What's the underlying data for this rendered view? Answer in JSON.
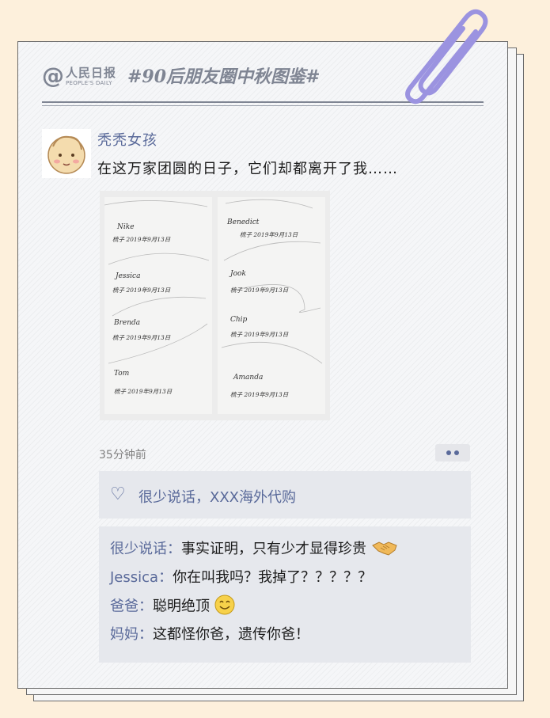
{
  "header": {
    "logo_cn": "人民日报",
    "logo_en": "PEOPLE'S DAILY",
    "hashtag": "#90后朋友圈中秋图鉴#"
  },
  "post": {
    "username": "秃秃女孩",
    "text": "在这万家团圆的日子，它们却都离开了我……",
    "photo": {
      "left_page": [
        {
          "name": "Nike",
          "line": "梳子 2019年9月13日"
        },
        {
          "name": "Jessica",
          "line": "梳子 2019年9月13日"
        },
        {
          "name": "Brenda",
          "line": "梳子 2019年9月13日"
        },
        {
          "name": "Tom",
          "line": "梳子 2019年9月13日"
        }
      ],
      "right_page": [
        {
          "name": "Benedict",
          "line": "梳子 2019年9月13日"
        },
        {
          "name": "Jook",
          "line": "梳子 2019年9月13日"
        },
        {
          "name": "Chip",
          "line": "梳子 2019年9月13日"
        },
        {
          "name": "Amanda",
          "line": "梳子 2019年9月13日"
        }
      ]
    },
    "time": "35分钟前",
    "likes": "很少说话，XXX海外代购",
    "comments": [
      {
        "author": "很少说话",
        "text": "事实证明，只有少才显得珍贵",
        "emoji": "handshake-icon"
      },
      {
        "author": "Jessica",
        "text": "你在叫我吗？我掉了？？？？？",
        "emoji": ""
      },
      {
        "author": "爸爸",
        "text": "聪明绝顶",
        "emoji": "smile-icon"
      },
      {
        "author": "妈妈",
        "text": "这都怪你爸，遗传你爸！",
        "emoji": ""
      }
    ]
  },
  "colors": {
    "background": "#fdf0dc",
    "accent": "#5a6a9a",
    "card": "#f5f6f8",
    "panel": "#e6e8ed",
    "clip": "#9b93e0"
  }
}
